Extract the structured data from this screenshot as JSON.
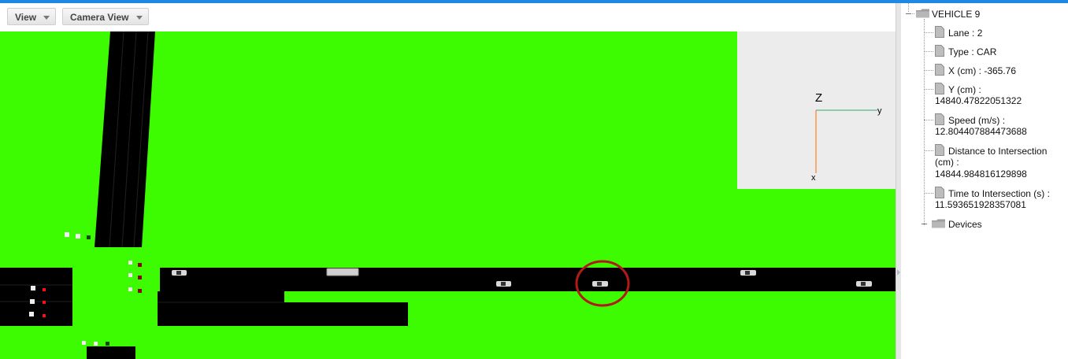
{
  "toolbar": {
    "view_label": "View",
    "camera_view_label": "Camera View"
  },
  "axes": {
    "z_label": "Z",
    "x_label": "x",
    "y_label": "y",
    "colors": {
      "x_axis": "#2ecc40",
      "y_axis": "#3344ff",
      "z_axis": "#ff6a00"
    }
  },
  "scene": {
    "ground_color": "#3dfb00",
    "road_color": "#000000",
    "highlight_color": "#b01a1a"
  },
  "tree": {
    "root": "VEHICLE 9",
    "items": [
      {
        "text": "Lane : 2"
      },
      {
        "text": "Type : CAR"
      },
      {
        "text": "X (cm) : -365.76"
      },
      {
        "text": "Y (cm) :",
        "value": "14840.47822051322"
      },
      {
        "text": "Speed (m/s) :",
        "value": "12.804407884473688"
      },
      {
        "text": "Distance to Intersection",
        "text2": "(cm) :",
        "value": "14844.984816129898"
      },
      {
        "text": "Time to Intersection (s) :",
        "value": "11.593651928357081"
      }
    ],
    "devices": "Devices"
  }
}
